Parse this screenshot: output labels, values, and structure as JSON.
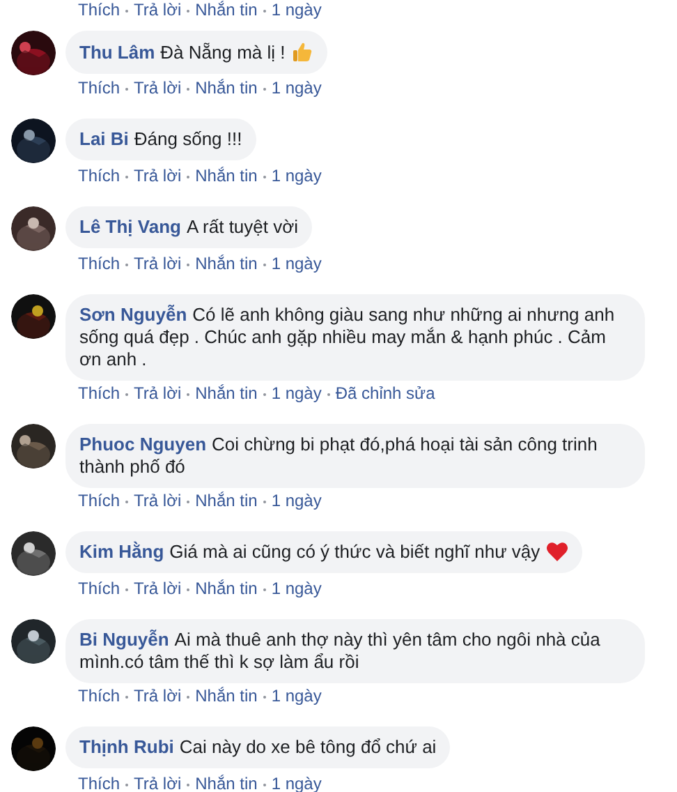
{
  "previous_comment_actions": {
    "actions": [
      "Thích",
      "Trả lời",
      "Nhắn tin"
    ],
    "time": "1 ngày"
  },
  "comments": [
    {
      "author": "Thu Lâm",
      "text": "Đà Nẵng mà lị !",
      "kind": "thumbsup",
      "actions": [
        "Thích",
        "Trả lời",
        "Nhắn tin"
      ],
      "time": "1 ngày"
    },
    {
      "author": "Lai Bi",
      "text": "Đáng sống !!!",
      "actions": [
        "Thích",
        "Trả lời",
        "Nhắn tin"
      ],
      "time": "1 ngày"
    },
    {
      "author": "Lê Thị Vang",
      "text": "A rất tuyệt vời",
      "actions": [
        "Thích",
        "Trả lời",
        "Nhắn tin"
      ],
      "time": "1 ngày"
    },
    {
      "author": "Sơn Nguyễn",
      "text": "Có lẽ anh không giàu sang như những ai nhưng anh sống quá đẹp . Chúc anh gặp nhiều may mắn & hạnh phúc . Cảm ơn anh .",
      "actions": [
        "Thích",
        "Trả lời",
        "Nhắn tin"
      ],
      "time": "1 ngày",
      "edited": "Đã chỉnh sửa"
    },
    {
      "author": "Phuoc Nguyen",
      "text": "Coi chừng bi phạt đó,phá hoại tài sản công trinh thành phố đó",
      "actions": [
        "Thích",
        "Trả lời",
        "Nhắn tin"
      ],
      "time": "1 ngày"
    },
    {
      "author": "Kim Hằng",
      "text": "Giá mà ai cũng có ý thức và biết nghĩ như vậy",
      "kind": "heart",
      "actions": [
        "Thích",
        "Trả lời",
        "Nhắn tin"
      ],
      "time": "1 ngày"
    },
    {
      "author": "Bi Nguyễn",
      "text": "Ai mà thuê anh thợ này thì yên tâm cho ngôi nhà của mình.có tâm thế thì k sợ làm ẩu rồi",
      "actions": [
        "Thích",
        "Trả lời",
        "Nhắn tin"
      ],
      "time": "1 ngày"
    },
    {
      "author": "Thịnh Rubi",
      "text": "Cai này do xe bê tông đổ chứ ai",
      "actions": [
        "Thích",
        "Trả lời",
        "Nhắn tin"
      ],
      "time": "1 ngày"
    }
  ]
}
